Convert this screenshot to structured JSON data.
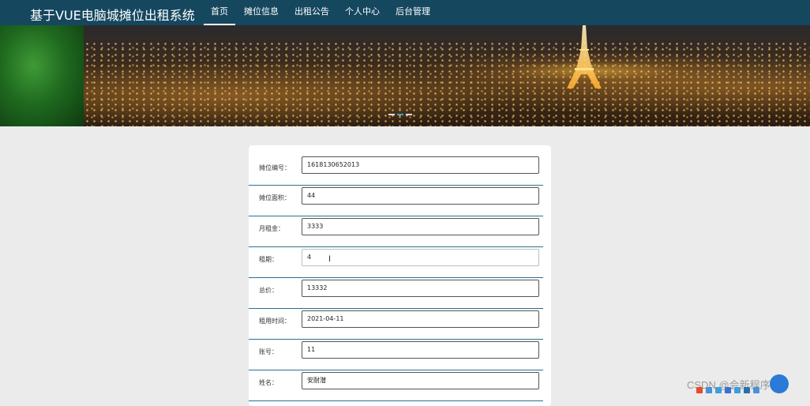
{
  "header": {
    "title": "基于VUE电脑城摊位出租系统",
    "nav": [
      {
        "label": "首页",
        "active": true
      },
      {
        "label": "摊位信息",
        "active": false
      },
      {
        "label": "出租公告",
        "active": false
      },
      {
        "label": "个人中心",
        "active": false
      },
      {
        "label": "后台管理",
        "active": false
      }
    ]
  },
  "banner": {
    "image": "city-night-eiffel-tower",
    "slide_indicators": 3,
    "active_slide": 2
  },
  "form": {
    "fields": [
      {
        "label": "摊位编号：",
        "value": "1618130652013"
      },
      {
        "label": "摊位面积：",
        "value": "44"
      },
      {
        "label": "月租金：",
        "value": "3333"
      },
      {
        "label": "租期：",
        "value": "4"
      },
      {
        "label": "总价：",
        "value": "13332"
      },
      {
        "label": "租用时间：",
        "value": "2021-04-11"
      },
      {
        "label": "账号：",
        "value": "11"
      },
      {
        "label": "姓名：",
        "value": "安耐潜"
      }
    ]
  },
  "watermark": "CSDN @会新程序设",
  "colors": {
    "header_bg": "#15475f",
    "row_divider": "#2f6e8e",
    "page_bg": "#ebebeb"
  }
}
